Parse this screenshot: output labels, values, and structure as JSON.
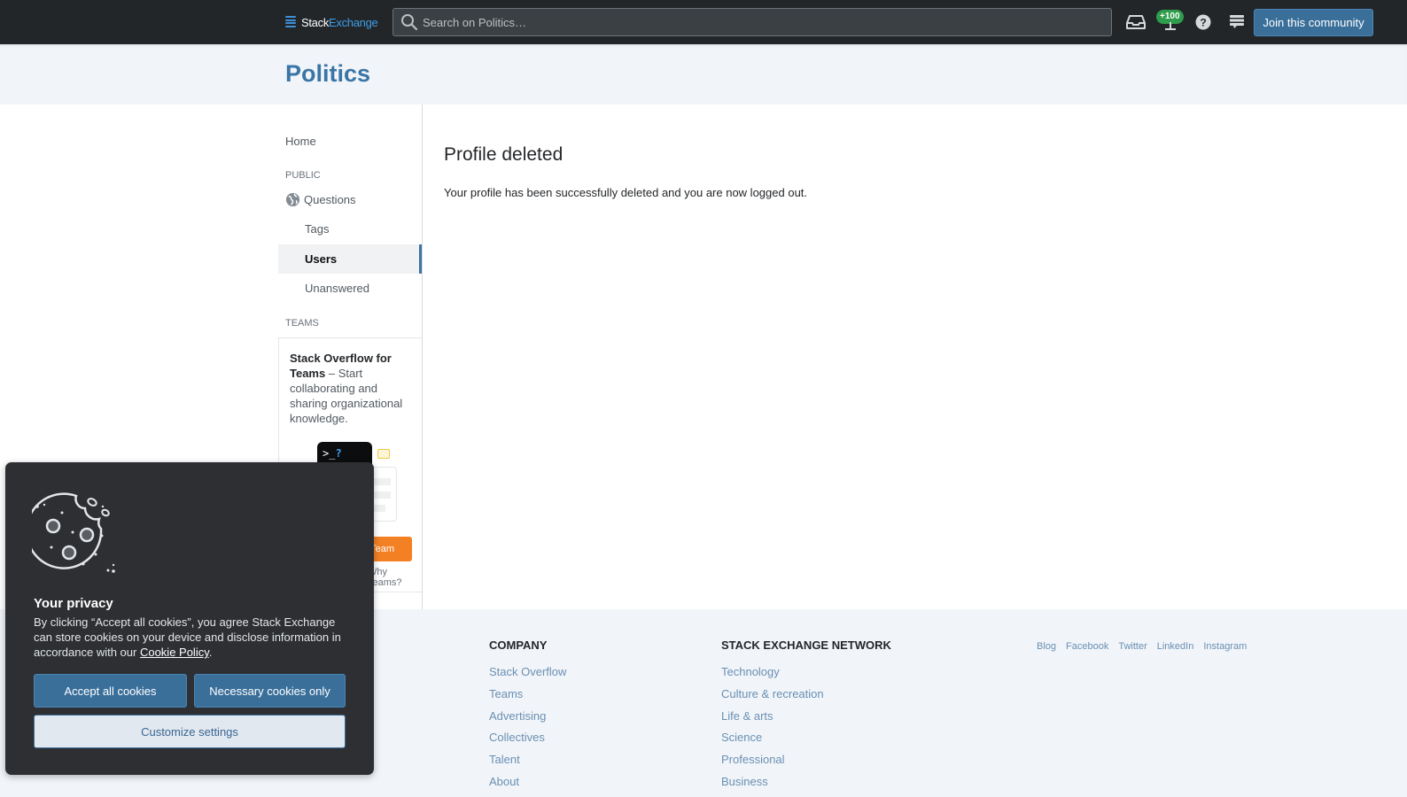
{
  "topbar": {
    "logo_word1": "Stack",
    "logo_word2": "Exchange",
    "search_placeholder": "Search on Politics…",
    "rep_badge": "+100",
    "join_label": "Join this community",
    "icons": [
      "inbox-icon",
      "achievements-icon",
      "help-icon",
      "site-switcher-icon"
    ]
  },
  "site": {
    "title": "Politics"
  },
  "sidebar": {
    "home": "Home",
    "public_label": "PUBLIC",
    "items": [
      {
        "label": "Questions",
        "icon": "globe-icon",
        "active": false
      },
      {
        "label": "Tags",
        "active": false
      },
      {
        "label": "Users",
        "active": true
      },
      {
        "label": "Unanswered",
        "active": false
      }
    ],
    "teams_label": "TEAMS",
    "teams_card": {
      "title": "Stack Overflow for Teams",
      "desc": " – Start collaborating and sharing organizational knowledge.",
      "terminal_prompt": ">_",
      "terminal_q": "?",
      "button_label": "Create a free Team",
      "why_link": "Why Teams?"
    }
  },
  "main": {
    "title": "Profile deleted",
    "message": "Your profile has been successfully deleted and you are now logged out."
  },
  "footer": {
    "company": {
      "heading": "COMPANY",
      "links": [
        "Stack Overflow",
        "Teams",
        "Advertising",
        "Collectives",
        "Talent",
        "About"
      ]
    },
    "network": {
      "heading": "STACK EXCHANGE NETWORK",
      "links": [
        "Technology",
        "Culture & recreation",
        "Life & arts",
        "Science",
        "Professional",
        "Business"
      ]
    },
    "social": [
      "Blog",
      "Facebook",
      "Twitter",
      "LinkedIn",
      "Instagram"
    ]
  },
  "cookie": {
    "title": "Your privacy",
    "text_before": "By clicking “Accept all cookies”, you agree Stack Exchange can store cookies on your device and disclose information in accordance with our ",
    "policy_link": "Cookie Policy",
    "text_after": ".",
    "accept_label": "Accept all cookies",
    "necessary_label": "Necessary cookies only",
    "customize_label": "Customize settings"
  }
}
